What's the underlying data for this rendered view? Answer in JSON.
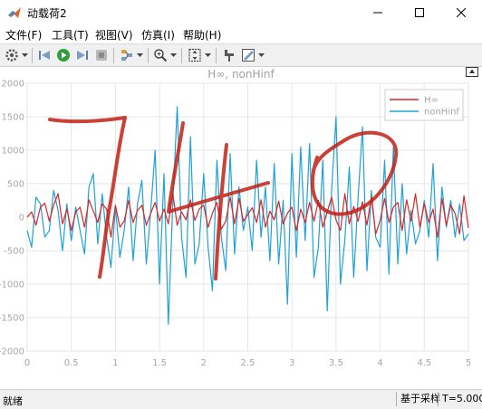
{
  "window": {
    "title": "动载荷2"
  },
  "menu": {
    "file": "文件(F)",
    "tools": "工具(T)",
    "view": "视图(V)",
    "simulation": "仿真(I)",
    "help": "帮助(H)"
  },
  "toolbar": {
    "icons": [
      "gear-icon",
      "step-back-icon",
      "run-icon",
      "step-forward-icon",
      "stop-icon",
      "highlight-icon",
      "zoom-icon",
      "autoscale-icon",
      "cursor-icon",
      "style-icon"
    ]
  },
  "plot": {
    "title": "H∞, nonHinf"
  },
  "colors": {
    "hinf": "#d62728",
    "nonhinf": "#1fa2d6",
    "grid": "#e6e6e6",
    "axis_text": "#a6a6a6"
  },
  "status": {
    "ready": "就绪",
    "mode": "基于采样",
    "time": "T=5.000"
  },
  "handwriting": {
    "text": "740",
    "color": "#c22015"
  },
  "chart_data": {
    "type": "line",
    "title": "H∞, nonHinf",
    "xlabel": "",
    "ylabel": "",
    "xlim": [
      0,
      5
    ],
    "ylim": [
      -2000,
      2000
    ],
    "xticks": [
      "0",
      "0.5",
      "1",
      "1.5",
      "2",
      "2.5",
      "3",
      "3.5",
      "4",
      "4.5",
      "5"
    ],
    "yticks": [
      "2000",
      "1500",
      "1000",
      "500",
      "0",
      "-500",
      "-1000",
      "-1500",
      "-2000"
    ],
    "grid": true,
    "legend_position": "top-right",
    "series": [
      {
        "name": "H∞",
        "color": "#d62728",
        "x": [
          0,
          0.05,
          0.1,
          0.15,
          0.2,
          0.25,
          0.3,
          0.35,
          0.4,
          0.45,
          0.5,
          0.55,
          0.6,
          0.65,
          0.7,
          0.75,
          0.8,
          0.85,
          0.9,
          0.95,
          1,
          1.05,
          1.1,
          1.15,
          1.2,
          1.25,
          1.3,
          1.35,
          1.4,
          1.45,
          1.5,
          1.55,
          1.6,
          1.65,
          1.7,
          1.75,
          1.8,
          1.85,
          1.9,
          1.95,
          2,
          2.05,
          2.1,
          2.15,
          2.2,
          2.25,
          2.3,
          2.35,
          2.4,
          2.45,
          2.5,
          2.55,
          2.6,
          2.65,
          2.7,
          2.75,
          2.8,
          2.85,
          2.9,
          2.95,
          3,
          3.05,
          3.1,
          3.15,
          3.2,
          3.25,
          3.3,
          3.35,
          3.4,
          3.45,
          3.5,
          3.55,
          3.6,
          3.65,
          3.7,
          3.75,
          3.8,
          3.85,
          3.9,
          3.95,
          4,
          4.05,
          4.1,
          4.15,
          4.2,
          4.25,
          4.3,
          4.35,
          4.4,
          4.45,
          4.5,
          4.55,
          4.6,
          4.65,
          4.7,
          4.75,
          4.8,
          4.85,
          4.9,
          4.95,
          5
        ],
        "values": [
          0,
          80,
          -120,
          150,
          210,
          -60,
          180,
          350,
          -100,
          120,
          -200,
          80,
          150,
          -150,
          260,
          90,
          -80,
          200,
          120,
          -300,
          180,
          -150,
          -60,
          250,
          -80,
          100,
          180,
          -120,
          60,
          220,
          -60,
          120,
          -100,
          350,
          -120,
          80,
          -40,
          260,
          -50,
          120,
          180,
          -150,
          60,
          220,
          -180,
          -60,
          300,
          -100,
          280,
          -60,
          40,
          140,
          -80,
          260,
          -150,
          90,
          -40,
          240,
          -100,
          60,
          150,
          -200,
          120,
          -80,
          220,
          -60,
          250,
          -150,
          80,
          300,
          -40,
          -200,
          350,
          -100,
          160,
          -60,
          230,
          -120,
          300,
          -250,
          -50,
          280,
          -80,
          150,
          220,
          -200,
          260,
          -60,
          350,
          -150,
          200,
          -80,
          120,
          -300,
          280,
          -120,
          180,
          50,
          -250,
          320,
          -160
        ]
      },
      {
        "name": "nonHinf",
        "color": "#1fa2d6",
        "x": [
          0,
          0.05,
          0.1,
          0.15,
          0.2,
          0.25,
          0.3,
          0.35,
          0.4,
          0.45,
          0.5,
          0.55,
          0.6,
          0.65,
          0.7,
          0.75,
          0.8,
          0.85,
          0.9,
          0.95,
          1,
          1.05,
          1.1,
          1.15,
          1.2,
          1.25,
          1.3,
          1.35,
          1.4,
          1.45,
          1.5,
          1.55,
          1.6,
          1.65,
          1.7,
          1.75,
          1.8,
          1.85,
          1.9,
          1.95,
          2,
          2.05,
          2.1,
          2.15,
          2.2,
          2.25,
          2.3,
          2.35,
          2.4,
          2.45,
          2.5,
          2.55,
          2.6,
          2.65,
          2.7,
          2.75,
          2.8,
          2.85,
          2.9,
          2.95,
          3,
          3.05,
          3.1,
          3.15,
          3.2,
          3.25,
          3.3,
          3.35,
          3.4,
          3.45,
          3.5,
          3.55,
          3.6,
          3.65,
          3.7,
          3.75,
          3.8,
          3.85,
          3.9,
          3.95,
          4,
          4.05,
          4.1,
          4.15,
          4.2,
          4.25,
          4.3,
          4.35,
          4.4,
          4.45,
          4.5,
          4.55,
          4.6,
          4.65,
          4.7,
          4.75,
          4.8,
          4.85,
          4.9,
          4.95,
          5
        ],
        "values": [
          -200,
          -450,
          300,
          200,
          -300,
          -200,
          400,
          100,
          -500,
          200,
          -350,
          150,
          -200,
          -550,
          450,
          650,
          -400,
          350,
          -300,
          -750,
          150,
          -600,
          -200,
          450,
          -650,
          200,
          550,
          -700,
          100,
          1000,
          -1000,
          650,
          -1600,
          200,
          1650,
          -300,
          -900,
          1200,
          -700,
          -400,
          650,
          -450,
          -1100,
          850,
          -300,
          -800,
          950,
          -550,
          450,
          -200,
          150,
          -500,
          850,
          -300,
          450,
          -650,
          800,
          -700,
          250,
          -1300,
          950,
          -600,
          1050,
          -350,
          1100,
          -900,
          -450,
          850,
          -1400,
          400,
          1500,
          -1000,
          -350,
          750,
          -900,
          300,
          1350,
          -800,
          400,
          -300,
          -450,
          850,
          -850,
          1050,
          -700,
          500,
          -550,
          100,
          -400,
          -200,
          250,
          -300,
          800,
          -650,
          450,
          -150,
          250,
          -300,
          200,
          -350,
          -250
        ]
      }
    ]
  }
}
